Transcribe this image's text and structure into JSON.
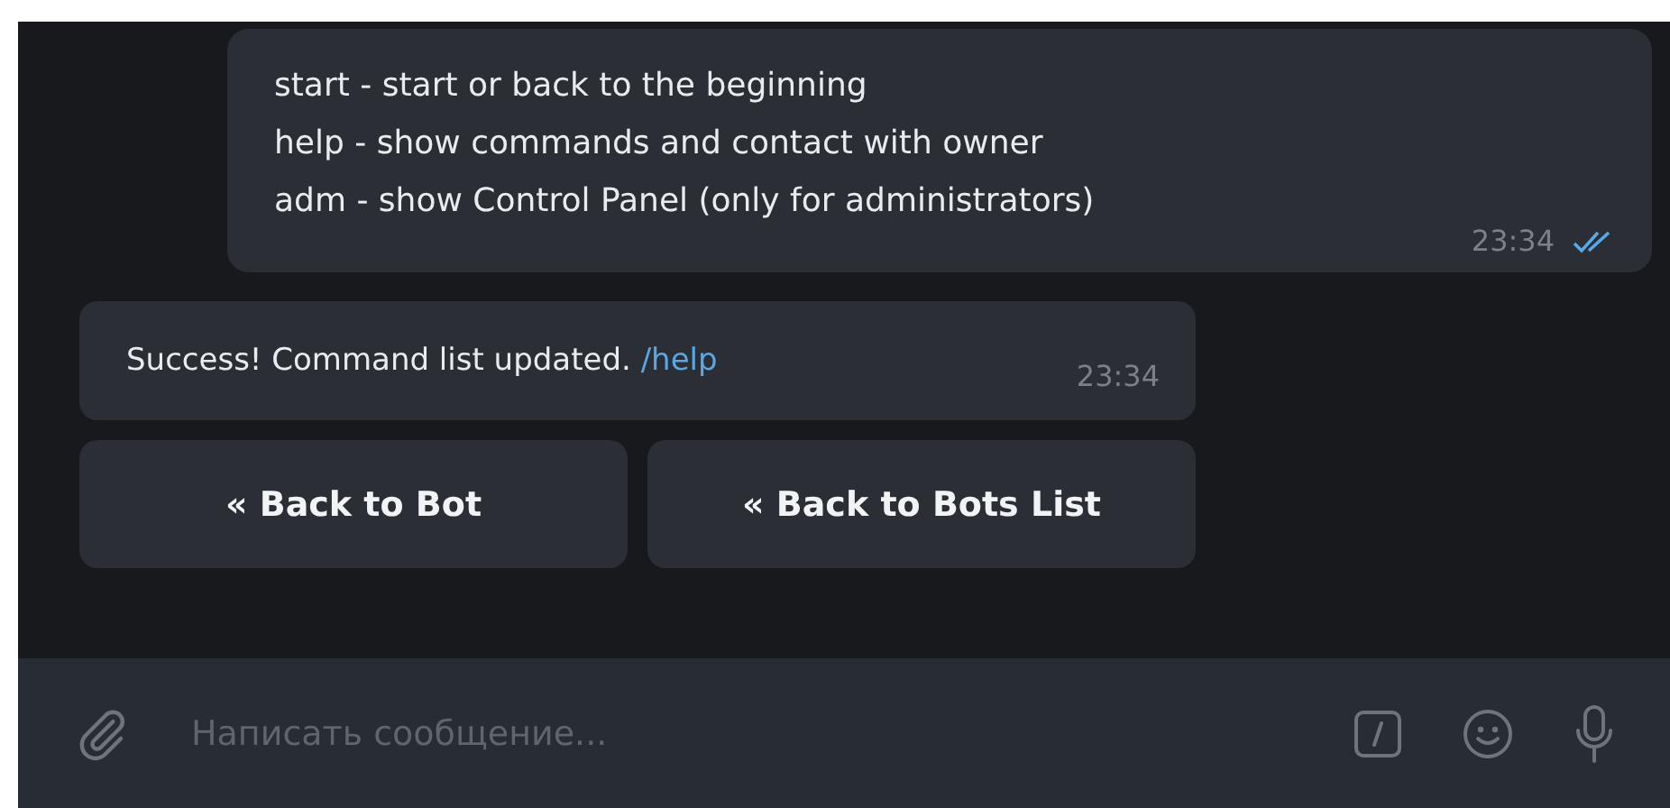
{
  "messages": [
    {
      "kind": "outgoing",
      "lines": [
        "start - start or back to the beginning",
        "help - show commands and contact with owner",
        "adm - show Control Panel (only for administrators)"
      ],
      "time": "23:34",
      "read": true
    },
    {
      "kind": "incoming",
      "text": "Success! Command list updated.",
      "link": "/help",
      "time": "23:34"
    }
  ],
  "keyboard": [
    "« Back to Bot",
    "« Back to Bots List"
  ],
  "composer": {
    "placeholder": "Написать сообщение..."
  }
}
